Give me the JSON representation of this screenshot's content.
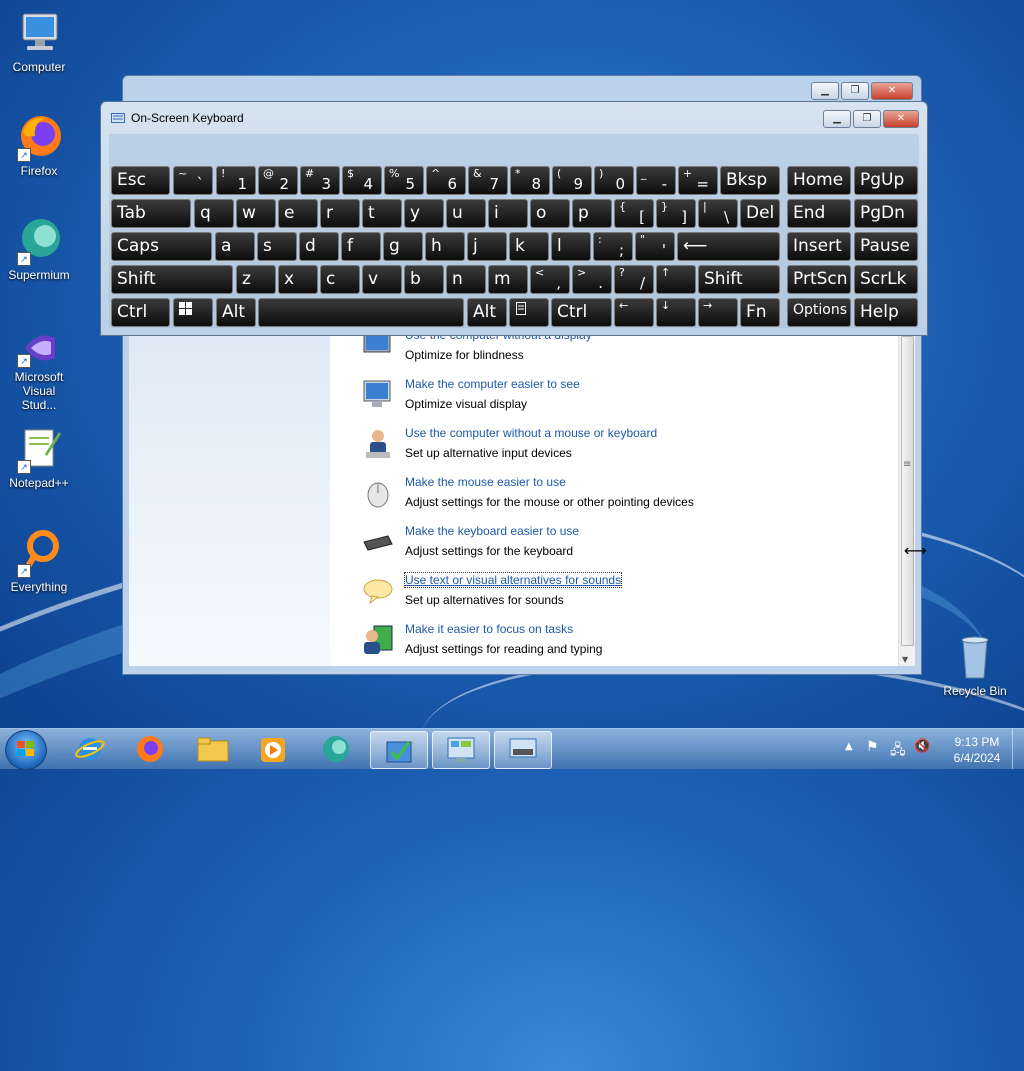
{
  "desktop": {
    "icons": [
      {
        "label": "Computer"
      },
      {
        "label": "Firefox"
      },
      {
        "label": "Supermium"
      },
      {
        "label": "Microsoft Visual Stud..."
      },
      {
        "label": "Notepad++"
      },
      {
        "label": "Everything"
      },
      {
        "label": "Recycle Bin"
      }
    ]
  },
  "osk": {
    "title": "On-Screen Keyboard",
    "keys": {
      "esc": "Esc",
      "bksp": "Bksp",
      "home": "Home",
      "pgup": "PgUp",
      "tab": "Tab",
      "del": "Del",
      "end": "End",
      "pgdn": "PgDn",
      "caps": "Caps",
      "insert": "Insert",
      "pause": "Pause",
      "shift": "Shift",
      "shift_r": "Shift",
      "prtscn": "PrtScn",
      "scrlk": "ScrLk",
      "ctrl": "Ctrl",
      "alt": "Alt",
      "alt_r": "Alt",
      "ctrl_r": "Ctrl",
      "fn": "Fn",
      "options": "Options",
      "help": "Help",
      "tilde_up": "~",
      "tilde_low": "`",
      "n1_up": "!",
      "n1": "1",
      "n2_up": "@",
      "n2": "2",
      "n3_up": "#",
      "n3": "3",
      "n4_up": "$",
      "n4": "4",
      "n5_up": "%",
      "n5": "5",
      "n6_up": "^",
      "n6": "6",
      "n7_up": "&",
      "n7": "7",
      "n8_up": "*",
      "n8": "8",
      "n9_up": "(",
      "n9": "9",
      "n0_up": ")",
      "n0": "0",
      "minus_up": "_",
      "minus": "-",
      "eq_up": "+",
      "eq": "=",
      "q": "q",
      "w": "w",
      "e": "e",
      "r": "r",
      "t": "t",
      "y": "y",
      "u": "u",
      "i": "i",
      "o": "o",
      "p": "p",
      "lb_up": "{",
      "lb": "[",
      "rb_up": "}",
      "rb": "]",
      "bs_up": "|",
      "bs": "\\",
      "a": "a",
      "s": "s",
      "d": "d",
      "f": "f",
      "g": "g",
      "h": "h",
      "j": "j",
      "k": "k",
      "l": "l",
      "semi_up": ":",
      "semi": ";",
      "quote_up": "\"",
      "quote": "'",
      "z": "z",
      "x": "x",
      "c": "c",
      "v": "v",
      "b": "b",
      "n": "n",
      "m": "m",
      "comma_up": "<",
      "comma": ",",
      "dot_up": ">",
      "dot": ".",
      "slash_up": "?",
      "slash": "/",
      "up": "↑",
      "left": "←",
      "down": "↓",
      "right": "→",
      "enter": "⟵"
    }
  },
  "control_panel": {
    "items": [
      {
        "link": "Use the computer without a display",
        "desc": "Optimize for blindness"
      },
      {
        "link": "Make the computer easier to see",
        "desc": "Optimize visual display"
      },
      {
        "link": "Use the computer without a mouse or keyboard",
        "desc": "Set up alternative input devices"
      },
      {
        "link": "Make the mouse easier to use",
        "desc": "Adjust settings for the mouse or other pointing devices"
      },
      {
        "link": "Make the keyboard easier to use",
        "desc": "Adjust settings for the keyboard"
      },
      {
        "link": "Use text or visual alternatives for sounds",
        "desc": "Set up alternatives for sounds"
      },
      {
        "link": "Make it easier to focus on tasks",
        "desc": "Adjust settings for reading and typing"
      }
    ]
  },
  "taskbar": {
    "time": "9:13 PM",
    "date": "6/4/2024"
  }
}
